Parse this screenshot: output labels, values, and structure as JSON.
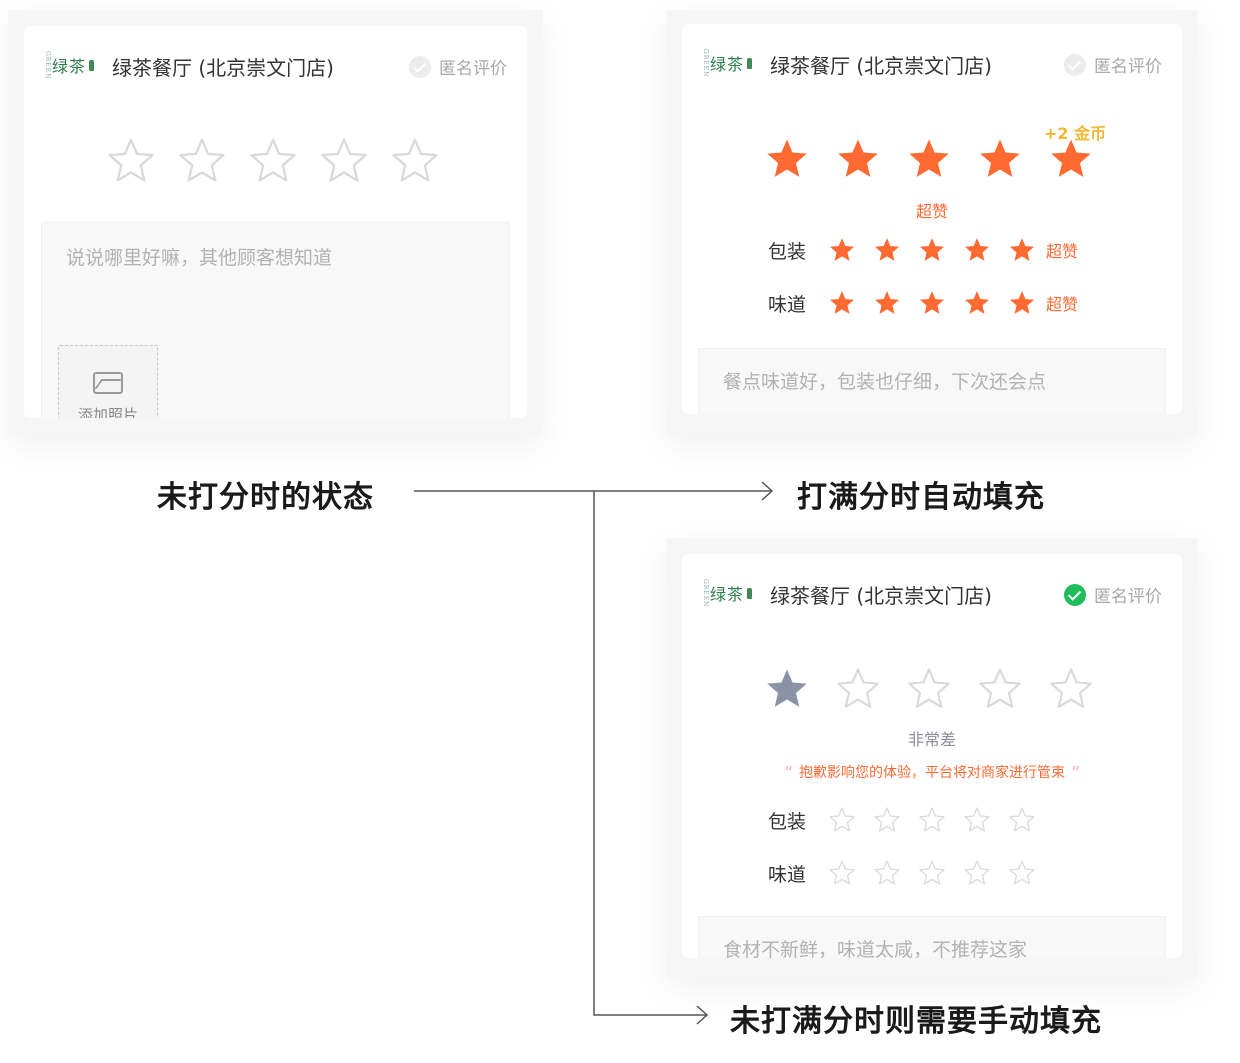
{
  "colors": {
    "accent_orange": "#ff6a33",
    "coin_yellow": "#f7b733",
    "check_green": "#1fbe5b",
    "gray_star": "#8a93a6",
    "empty_star_outline": "#d9d9d9"
  },
  "cards": [
    {
      "logo": "绿茶",
      "store_name": "绿茶餐厅 (北京崇文门店)",
      "anonymous_label": "匿名评价",
      "anonymous_checked": false,
      "overall_rating": 0,
      "max_rating": 5,
      "textarea_placeholder": "说说哪里好嘛，其他顾客想知道",
      "add_photo_label": "添加照片",
      "caption": "未打分时的状态"
    },
    {
      "logo": "绿茶",
      "store_name": "绿茶餐厅 (北京崇文门店)",
      "anonymous_label": "匿名评价",
      "anonymous_checked": false,
      "overall_rating": 5,
      "max_rating": 5,
      "coin_bonus": "+2 金币",
      "rating_text": "超赞",
      "sub_ratings": [
        {
          "label": "包装",
          "rating": 5,
          "text": "超赞"
        },
        {
          "label": "味道",
          "rating": 5,
          "text": "超赞"
        }
      ],
      "textarea_placeholder": "餐点味道好，包装也仔细，下次还会点",
      "caption": "打满分时自动填充"
    },
    {
      "logo": "绿茶",
      "store_name": "绿茶餐厅 (北京崇文门店)",
      "anonymous_label": "匿名评价",
      "anonymous_checked": true,
      "overall_rating": 1,
      "max_rating": 5,
      "rating_text": "非常差",
      "apology_text": "抱歉影响您的体验，平台将对商家进行管束",
      "sub_ratings": [
        {
          "label": "包装",
          "rating": 0
        },
        {
          "label": "味道",
          "rating": 0
        }
      ],
      "textarea_placeholder": "食材不新鲜，味道太咸，不推荐这家",
      "caption": "未打满分时则需要手动填充"
    }
  ],
  "icons": {
    "star": "star-icon",
    "check": "check-circle-icon",
    "photo": "image-icon"
  }
}
